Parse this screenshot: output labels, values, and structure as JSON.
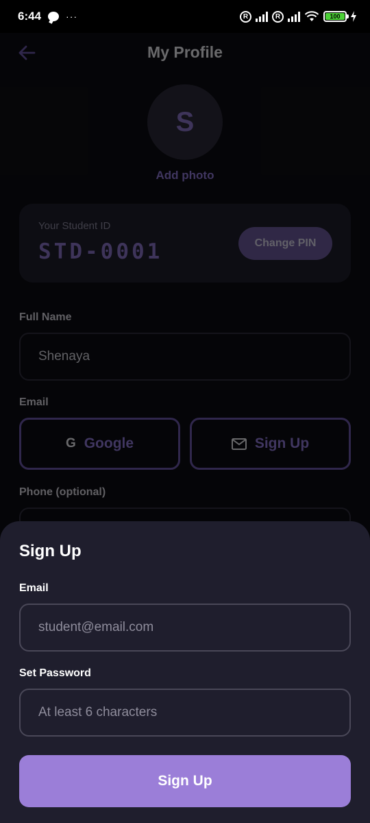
{
  "status_bar": {
    "time": "6:44",
    "dots": "···",
    "battery": "100",
    "registered_mark": "R"
  },
  "header": {
    "title": "My Profile"
  },
  "profile": {
    "avatar_initial": "S",
    "add_photo": "Add photo"
  },
  "student_card": {
    "label": "Your Student ID",
    "value": "STD-0001",
    "change_pin": "Change PIN"
  },
  "form": {
    "full_name_label": "Full Name",
    "full_name_value": "Shenaya",
    "email_label": "Email",
    "google_icon_glyph": "G",
    "google_label": "Google",
    "signup_label": "Sign Up",
    "phone_label": "Phone (optional)"
  },
  "sheet": {
    "title": "Sign Up",
    "email_label": "Email",
    "email_placeholder": "student@email.com",
    "password_label": "Set Password",
    "password_placeholder": "At least 6 characters",
    "submit_label": "Sign Up"
  },
  "colors": {
    "accent": "#9b7ed8",
    "accent_text": "#8f78d6",
    "background": "#0d0d12",
    "sheet_background": "#1f1e2d"
  }
}
